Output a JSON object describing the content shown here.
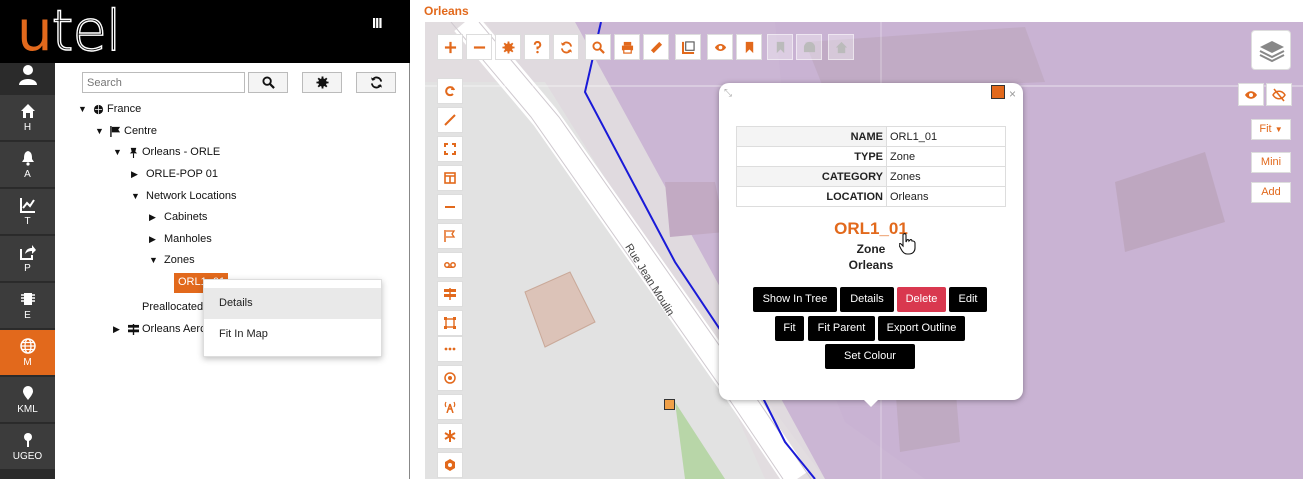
{
  "app": {
    "logo_u": "u",
    "logo_rest": "tel",
    "menu_toggle": "III"
  },
  "nav": [
    {
      "label": "H",
      "icon": "home-icon"
    },
    {
      "label": "A",
      "icon": "bell-icon"
    },
    {
      "label": "T",
      "icon": "chart-icon"
    },
    {
      "label": "P",
      "icon": "share-icon"
    },
    {
      "label": "E",
      "icon": "chip-icon"
    },
    {
      "label": "M",
      "icon": "globe-icon",
      "active": true
    },
    {
      "label": "KML",
      "icon": "pin-icon"
    },
    {
      "label": "UGEO",
      "icon": "map-pin-icon"
    }
  ],
  "tree": {
    "search_placeholder": "Search",
    "nodes": {
      "france": "France",
      "centre": "Centre",
      "orleans": "Orleans - ORLE",
      "pop": "ORLE-POP 01",
      "netloc": "Network Locations",
      "cabinets": "Cabinets",
      "manholes": "Manholes",
      "zones": "Zones",
      "selected": "ORL1_01",
      "preallocated": "Preallocated",
      "orleans_aero": "Orleans Aerc"
    },
    "context_menu": [
      "Details",
      "Fit In Map"
    ]
  },
  "map": {
    "title": "Orleans",
    "street": "Rue Jean Moulin",
    "right_buttons": {
      "fit": "Fit",
      "mini": "Mini",
      "add": "Add"
    },
    "popup": {
      "rows": [
        {
          "key": "NAME",
          "value": "ORL1_01"
        },
        {
          "key": "TYPE",
          "value": "Zone"
        },
        {
          "key": "CATEGORY",
          "value": "Zones"
        },
        {
          "key": "LOCATION",
          "value": "Orleans"
        }
      ],
      "name": "ORL1_01",
      "type": "Zone",
      "location": "Orleans",
      "close": "×",
      "buttons": {
        "show_in_tree": "Show In Tree",
        "details": "Details",
        "delete": "Delete",
        "edit": "Edit",
        "fit": "Fit",
        "fit_parent": "Fit Parent",
        "export_outline": "Export Outline",
        "set_colour": "Set Colour"
      }
    }
  },
  "colors": {
    "accent": "#e2691c",
    "delete": "#d9384f",
    "zone_fill": "#cbb6d4",
    "boundary": "#1a1ad8"
  }
}
